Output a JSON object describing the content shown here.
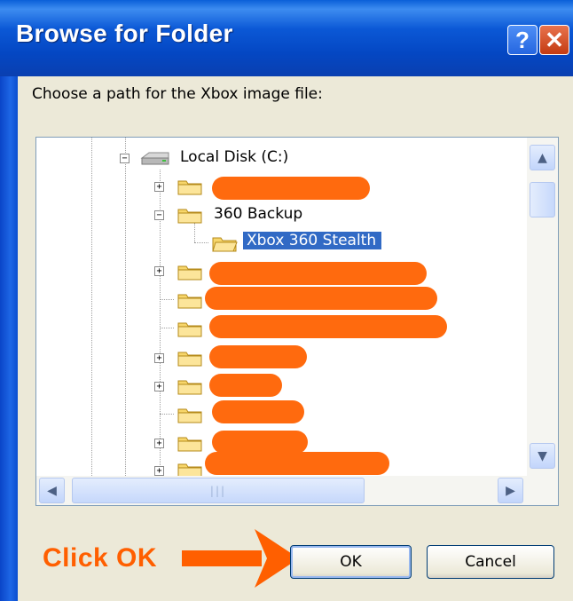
{
  "window": {
    "title": "Browse for Folder",
    "help_glyph": "?",
    "close_glyph": "✕"
  },
  "prompt": "Choose a path for the Xbox image file:",
  "tree": {
    "root": {
      "label": "Local Disk (C:)",
      "icon": "hard-drive-icon",
      "expander": "−"
    },
    "items": [
      {
        "label": "",
        "redacted": true,
        "expander": "+"
      },
      {
        "label": "360 Backup",
        "expander": "−"
      },
      {
        "label": "Xbox 360 Stealth",
        "selected": true,
        "indent": 2
      },
      {
        "label": "",
        "redacted": true,
        "expander": "+"
      },
      {
        "label": "",
        "redacted": true
      },
      {
        "label": "",
        "redacted": true
      },
      {
        "label": "",
        "redacted": true,
        "expander": "+"
      },
      {
        "label": "",
        "redacted": true,
        "expander": "+"
      },
      {
        "label": "",
        "redacted": true
      },
      {
        "label": "",
        "redacted": true,
        "expander": "+"
      },
      {
        "label": "",
        "redacted": true,
        "expander": "+"
      }
    ]
  },
  "annotation": "Click OK",
  "buttons": {
    "ok": "OK",
    "cancel": "Cancel"
  },
  "colors": {
    "titlebar": "#0b58d6",
    "selection": "#316ac5",
    "redaction": "#ff6a0e",
    "annotation": "#ff5f00",
    "dialog_face": "#ece9d8"
  }
}
